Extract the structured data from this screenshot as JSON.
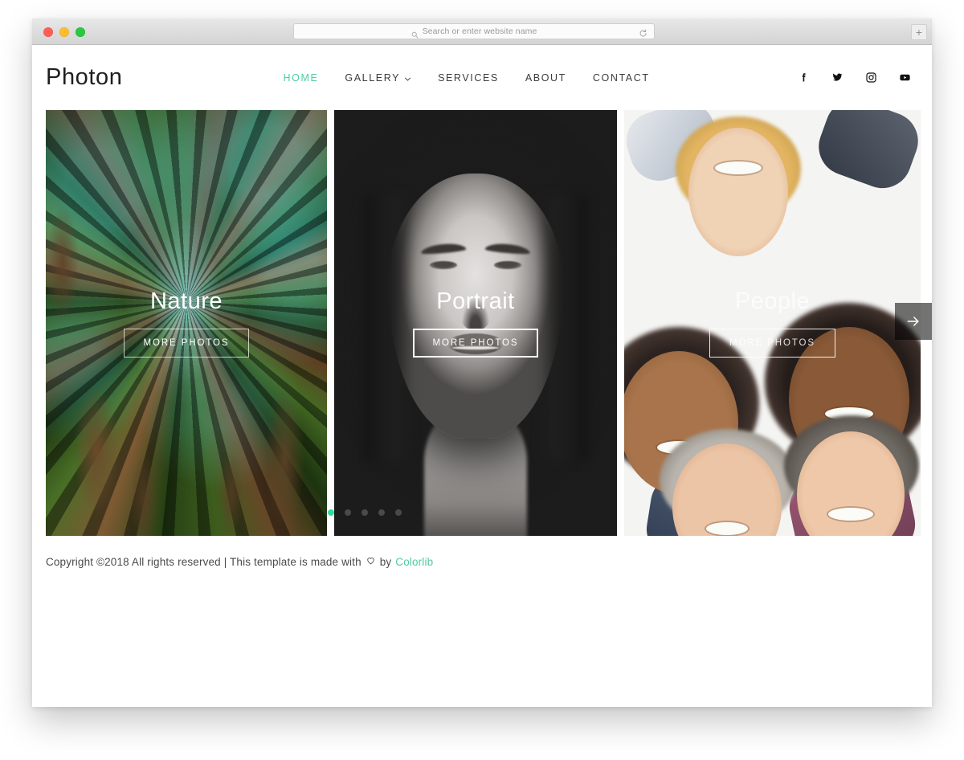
{
  "browser": {
    "window_controls": [
      "close",
      "minimize",
      "maximize"
    ],
    "address_bar": {
      "placeholder": "Search or enter website name",
      "value": "",
      "search_icon": "search-icon",
      "reload_icon": "reload-icon"
    },
    "new_tab_label": "+"
  },
  "site": {
    "logo": "Photon",
    "nav": [
      {
        "label": "HOME",
        "active": true,
        "has_dropdown": false
      },
      {
        "label": "GALLERY",
        "active": false,
        "has_dropdown": true
      },
      {
        "label": "SERVICES",
        "active": false,
        "has_dropdown": false
      },
      {
        "label": "ABOUT",
        "active": false,
        "has_dropdown": false
      },
      {
        "label": "CONTACT",
        "active": false,
        "has_dropdown": false
      }
    ],
    "socials": [
      {
        "name": "facebook-icon",
        "label": "Facebook"
      },
      {
        "name": "twitter-icon",
        "label": "Twitter"
      },
      {
        "name": "instagram-icon",
        "label": "Instagram"
      },
      {
        "name": "youtube-icon",
        "label": "YouTube"
      }
    ],
    "accent_color": "#4ecca3",
    "dot_active_color": "#2ddba0"
  },
  "slider": {
    "slides": [
      {
        "title": "Nature",
        "button_label": "MORE PHOTOS",
        "theme": "forest"
      },
      {
        "title": "Portrait",
        "button_label": "MORE PHOTOS",
        "theme": "bw-portrait"
      },
      {
        "title": "People",
        "button_label": "MORE PHOTOS",
        "theme": "group"
      }
    ],
    "next_arrow_icon": "arrow-right-icon",
    "pagination": {
      "count": 5,
      "active_index": 0
    }
  },
  "footer": {
    "copyright": "Copyright ©2018 All rights reserved | This template is made with",
    "heart_icon": "heart-outline-icon",
    "by": "by",
    "brand": "Colorlib"
  }
}
